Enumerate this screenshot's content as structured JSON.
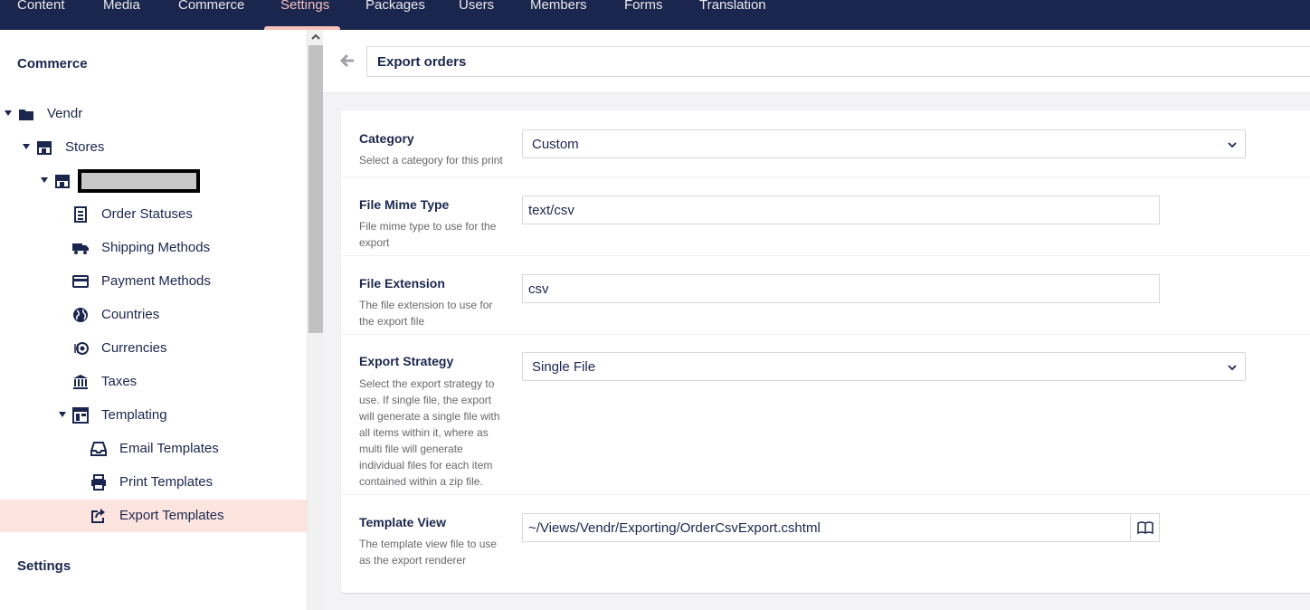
{
  "topnav": {
    "tabs": [
      {
        "label": "Content"
      },
      {
        "label": "Media"
      },
      {
        "label": "Commerce"
      },
      {
        "label": "Settings",
        "active": true
      },
      {
        "label": "Packages"
      },
      {
        "label": "Users"
      },
      {
        "label": "Members"
      },
      {
        "label": "Forms"
      },
      {
        "label": "Translation"
      }
    ]
  },
  "sidebar": {
    "section_commerce": "Commerce",
    "section_settings": "Settings",
    "tree": {
      "vendr": "Vendr",
      "stores": "Stores",
      "order_statuses": "Order Statuses",
      "shipping_methods": "Shipping Methods",
      "payment_methods": "Payment Methods",
      "countries": "Countries",
      "currencies": "Currencies",
      "taxes": "Taxes",
      "templating": "Templating",
      "email_templates": "Email Templates",
      "print_templates": "Print Templates",
      "export_templates": "Export Templates"
    }
  },
  "editor": {
    "name": "Export orders",
    "properties": {
      "category": {
        "label": "Category",
        "description": "Select a category for this print",
        "value": "Custom"
      },
      "mime": {
        "label": "File Mime Type",
        "description": "File mime type to use for the export",
        "value": "text/csv"
      },
      "extension": {
        "label": "File Extension",
        "description": "The file extension to use for the export file",
        "value": "csv"
      },
      "strategy": {
        "label": "Export Strategy",
        "description": "Select the export strategy to use. If single file, the export will generate a single file with all items within it, where as multi file will generate individual files for each item contained within a zip file.",
        "value": "Single File"
      },
      "template_view": {
        "label": "Template View",
        "description": "The template view file to use as the export renderer",
        "value": "~/Views/Vendr/Exporting/OrderCsvExport.cshtml"
      }
    }
  },
  "colors": {
    "nav_bg": "#1b264f",
    "nav_active": "#f5c1bc",
    "sidebar_active_bg": "#fde4df"
  }
}
